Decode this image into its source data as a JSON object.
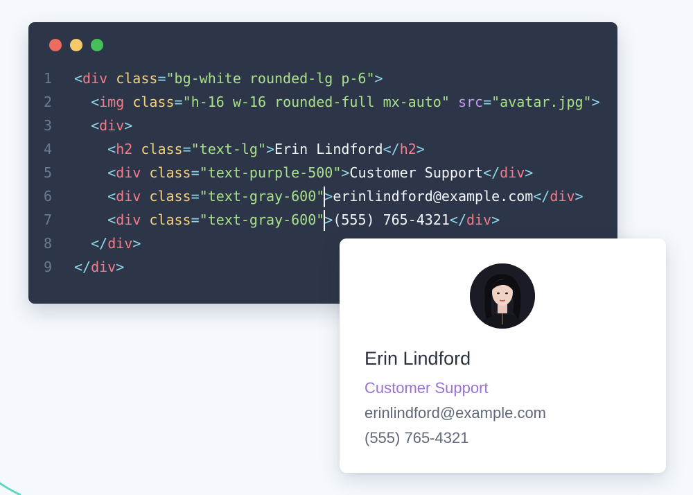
{
  "window": {
    "controls": [
      {
        "name": "close",
        "color": "#ee6b60"
      },
      {
        "name": "minimize",
        "color": "#f6c96a"
      },
      {
        "name": "maximize",
        "color": "#47c05c"
      }
    ]
  },
  "code": {
    "lines": [
      {
        "number": "1",
        "indent": "",
        "tokens": [
          {
            "t": "punct",
            "v": "<"
          },
          {
            "t": "tag",
            "v": "div"
          },
          {
            "t": "text",
            "v": " "
          },
          {
            "t": "attr",
            "v": "class"
          },
          {
            "t": "eq",
            "v": "="
          },
          {
            "t": "str",
            "v": "\"bg-white rounded-lg p-6\""
          },
          {
            "t": "punct",
            "v": ">"
          }
        ]
      },
      {
        "number": "2",
        "indent": "  ",
        "tokens": [
          {
            "t": "punct",
            "v": "<"
          },
          {
            "t": "tag",
            "v": "img"
          },
          {
            "t": "text",
            "v": " "
          },
          {
            "t": "attr",
            "v": "class"
          },
          {
            "t": "eq",
            "v": "="
          },
          {
            "t": "str",
            "v": "\"h-16 w-16 rounded-full mx-auto\""
          },
          {
            "t": "text",
            "v": " "
          },
          {
            "t": "src",
            "v": "src"
          },
          {
            "t": "eq",
            "v": "="
          },
          {
            "t": "str",
            "v": "\"avatar.jpg\""
          },
          {
            "t": "punct",
            "v": ">"
          }
        ]
      },
      {
        "number": "3",
        "indent": "  ",
        "tokens": [
          {
            "t": "punct",
            "v": "<"
          },
          {
            "t": "tag",
            "v": "div"
          },
          {
            "t": "punct",
            "v": ">"
          }
        ]
      },
      {
        "number": "4",
        "indent": "    ",
        "tokens": [
          {
            "t": "punct",
            "v": "<"
          },
          {
            "t": "tag",
            "v": "h2"
          },
          {
            "t": "text",
            "v": " "
          },
          {
            "t": "attr",
            "v": "class"
          },
          {
            "t": "eq",
            "v": "="
          },
          {
            "t": "str",
            "v": "\"text-lg\""
          },
          {
            "t": "punct",
            "v": ">"
          },
          {
            "t": "text",
            "v": "Erin Lindford"
          },
          {
            "t": "punct",
            "v": "</"
          },
          {
            "t": "tag",
            "v": "h2"
          },
          {
            "t": "punct",
            "v": ">"
          }
        ]
      },
      {
        "number": "5",
        "indent": "    ",
        "tokens": [
          {
            "t": "punct",
            "v": "<"
          },
          {
            "t": "tag",
            "v": "div"
          },
          {
            "t": "text",
            "v": " "
          },
          {
            "t": "attr",
            "v": "class"
          },
          {
            "t": "eq",
            "v": "="
          },
          {
            "t": "str",
            "v": "\"text-purple-500\""
          },
          {
            "t": "punct",
            "v": ">"
          },
          {
            "t": "text",
            "v": "Customer Support"
          },
          {
            "t": "punct",
            "v": "</"
          },
          {
            "t": "tag",
            "v": "div"
          },
          {
            "t": "punct",
            "v": ">"
          }
        ]
      },
      {
        "number": "6",
        "indent": "    ",
        "tokens": [
          {
            "t": "punct",
            "v": "<"
          },
          {
            "t": "tag",
            "v": "div"
          },
          {
            "t": "text",
            "v": " "
          },
          {
            "t": "attr",
            "v": "class"
          },
          {
            "t": "eq",
            "v": "="
          },
          {
            "t": "str",
            "v": "\"text-gray-600\""
          },
          {
            "t": "cursor",
            "v": ""
          },
          {
            "t": "punct",
            "v": ">"
          },
          {
            "t": "text",
            "v": "erinlindford@example.com"
          },
          {
            "t": "punct",
            "v": "</"
          },
          {
            "t": "tag",
            "v": "div"
          },
          {
            "t": "punct",
            "v": ">"
          }
        ]
      },
      {
        "number": "7",
        "indent": "    ",
        "tokens": [
          {
            "t": "punct",
            "v": "<"
          },
          {
            "t": "tag",
            "v": "div"
          },
          {
            "t": "text",
            "v": " "
          },
          {
            "t": "attr",
            "v": "class"
          },
          {
            "t": "eq",
            "v": "="
          },
          {
            "t": "str",
            "v": "\"text-gray-600\""
          },
          {
            "t": "cursor",
            "v": ""
          },
          {
            "t": "punct",
            "v": ">"
          },
          {
            "t": "text",
            "v": "(555) 765-4321"
          },
          {
            "t": "punct",
            "v": "</"
          },
          {
            "t": "tag",
            "v": "div"
          },
          {
            "t": "punct",
            "v": ">"
          }
        ]
      },
      {
        "number": "8",
        "indent": "  ",
        "tokens": [
          {
            "t": "punct",
            "v": "</"
          },
          {
            "t": "tag",
            "v": "div"
          },
          {
            "t": "punct",
            "v": ">"
          }
        ]
      },
      {
        "number": "9",
        "indent": "",
        "tokens": [
          {
            "t": "punct",
            "v": "</"
          },
          {
            "t": "tag",
            "v": "div"
          },
          {
            "t": "punct",
            "v": ">"
          }
        ]
      }
    ]
  },
  "card": {
    "avatar_icon": "avatar-photo",
    "name": "Erin Lindford",
    "role": "Customer Support",
    "email": "erinlindford@example.com",
    "phone": "(555) 765-4321"
  },
  "colors": {
    "editor_bg": "#2d3648",
    "page_bg": "#f5f9fd",
    "accent_purple": "#9a72d6"
  }
}
